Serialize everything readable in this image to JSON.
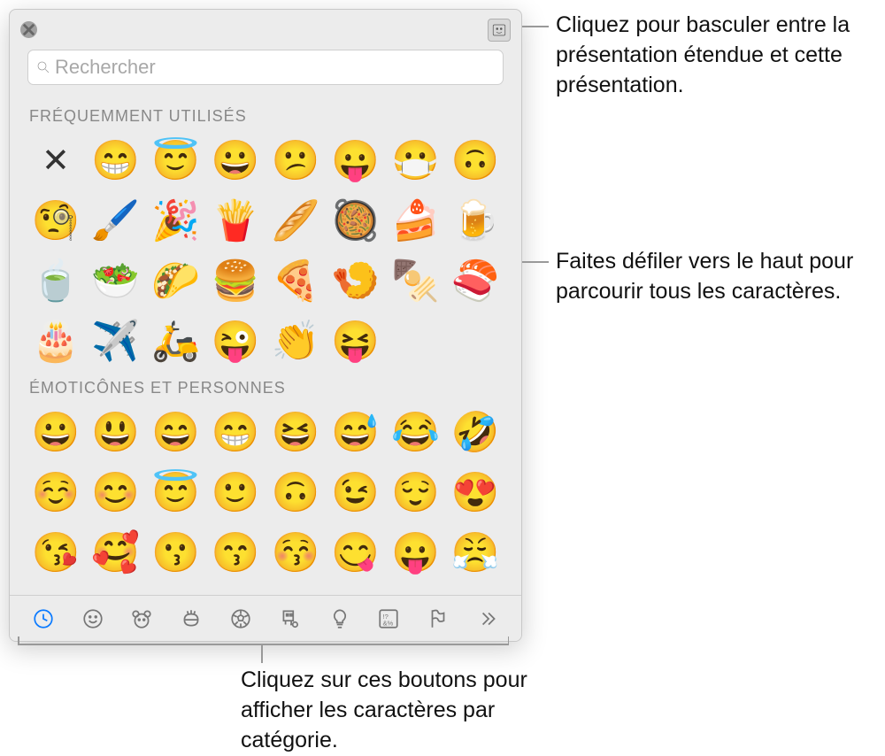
{
  "search": {
    "placeholder": "Rechercher"
  },
  "sections": {
    "frequent": {
      "title": "FRÉQUEMMENT UTILISÉS"
    },
    "smileys": {
      "title": "ÉMOTICÔNES ET PERSONNES"
    }
  },
  "frequent_emojis": [
    "✕",
    "😁",
    "😇",
    "😀",
    "😕",
    "😛",
    "😷",
    "🙃",
    "🧐",
    "🖌️",
    "🎉",
    "🍟",
    "🥖",
    "🥘",
    "🍰",
    "🍺",
    "🍵",
    "🥗",
    "🌮",
    "🍔",
    "🍕",
    "🍤",
    "🍢",
    "🍣",
    "🎂",
    "✈️",
    "🛵",
    "😜",
    "👏",
    "😝"
  ],
  "smiley_emojis": [
    "😀",
    "😃",
    "😄",
    "😁",
    "😆",
    "😅",
    "😂",
    "🤣",
    "☺️",
    "😊",
    "😇",
    "🙂",
    "🙃",
    "😉",
    "😌",
    "😍",
    "😘",
    "🥰",
    "😗",
    "😙",
    "😚",
    "😋",
    "😛",
    "😤"
  ],
  "category_icons": [
    "clock",
    "smiley",
    "animal",
    "food",
    "sports",
    "travel",
    "objects",
    "symbols",
    "flags",
    "more"
  ],
  "callouts": {
    "c1": "Cliquez pour basculer entre la présentation étendue et cette présentation.",
    "c2": "Faites défiler vers le haut pour parcourir tous les caractères.",
    "c3": "Cliquez sur ces boutons pour afficher les caractères par catégorie."
  }
}
